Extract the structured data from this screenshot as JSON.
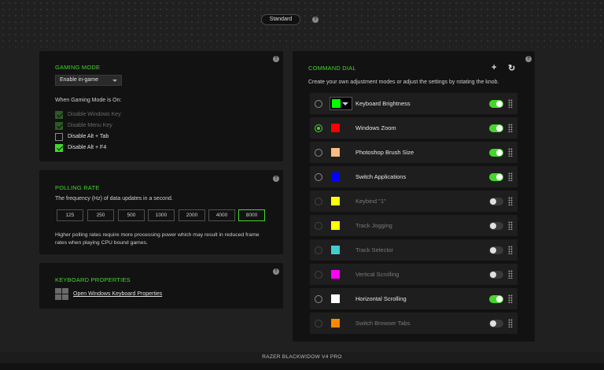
{
  "header": {
    "mode_label": "Standard",
    "help": "?"
  },
  "gaming_mode": {
    "title": "GAMING MODE",
    "select_value": "Enable in-game",
    "subtitle": "When Gaming Mode is On:",
    "options": [
      {
        "label": "Disable Windows Key",
        "checked": true,
        "enabled": false
      },
      {
        "label": "Disable Menu Key",
        "checked": true,
        "enabled": false
      },
      {
        "label": "Disable Alt + Tab",
        "checked": false,
        "enabled": true
      },
      {
        "label": "Disable Alt + F4",
        "checked": true,
        "enabled": true
      }
    ]
  },
  "polling_rate": {
    "title": "POLLING RATE",
    "description": "The frequency (Hz) of data updates in a second.",
    "rates": [
      "125",
      "250",
      "500",
      "1000",
      "2000",
      "4000",
      "8000"
    ],
    "selected": "8000",
    "note_line1": "Higher polling rates require more processing power which may result in reduced frame",
    "note_line2": "rates when playing CPU bound games."
  },
  "keyboard_properties": {
    "title": "KEYBOARD PROPERTIES",
    "link": "Open Windows Keyboard Properties"
  },
  "command_dial": {
    "title": "COMMAND DIAL",
    "description": "Create your own adjustment modes or adjust the settings by rotating the knob.",
    "add_icon": "plus-icon",
    "reset_icon": "refresh-icon",
    "rows": [
      {
        "label": "Keyboard Brightness",
        "color": "#00ff00",
        "enabled": true,
        "selected": false
      },
      {
        "label": "Windows Zoom",
        "color": "#ff0000",
        "enabled": true,
        "selected": true
      },
      {
        "label": "Photoshop Brush Size",
        "color": "#ffbb80",
        "enabled": true,
        "selected": false
      },
      {
        "label": "Switch Applications",
        "color": "#0000ff",
        "enabled": true,
        "selected": false
      },
      {
        "label": "Keybind \"1\"",
        "color": "#ffff00",
        "enabled": false,
        "selected": false
      },
      {
        "label": "Track Jogging",
        "color": "#ffff00",
        "enabled": false,
        "selected": false
      },
      {
        "label": "Track Selector",
        "color": "#44cccc",
        "enabled": false,
        "selected": false
      },
      {
        "label": "Vertical Scrolling",
        "color": "#ff00ff",
        "enabled": false,
        "selected": false
      },
      {
        "label": "Horizontal Scrolling",
        "color": "#ffffff",
        "enabled": true,
        "selected": false
      },
      {
        "label": "Switch Browser Tabs",
        "color": "#ff8800",
        "enabled": false,
        "selected": false
      }
    ]
  },
  "footer": {
    "device_name": "RAZER BLACKWIDOW V4 PRO"
  },
  "colors": {
    "accent": "#44d62c",
    "panel": "#121212",
    "background": "#202020"
  }
}
